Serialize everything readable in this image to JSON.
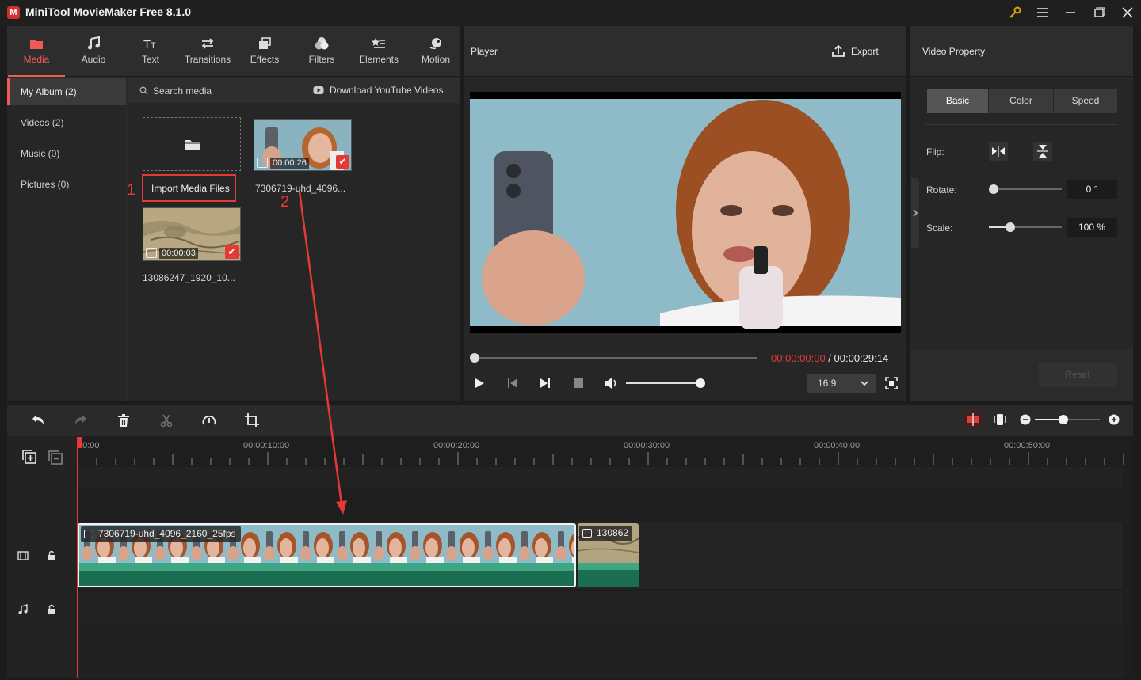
{
  "window": {
    "title": "MiniTool MovieMaker Free 8.1.0",
    "logo_letter": "M"
  },
  "toolbar_tabs": [
    {
      "label": "Media",
      "icon": "media-icon",
      "active": true
    },
    {
      "label": "Audio",
      "icon": "music-note-icon"
    },
    {
      "label": "Text",
      "icon": "text-icon"
    },
    {
      "label": "Transitions",
      "icon": "transitions-icon"
    },
    {
      "label": "Effects",
      "icon": "effects-icon"
    },
    {
      "label": "Filters",
      "icon": "filters-icon"
    },
    {
      "label": "Elements",
      "icon": "elements-icon"
    },
    {
      "label": "Motion",
      "icon": "motion-icon"
    }
  ],
  "album": {
    "items": [
      {
        "label": "My Album (2)",
        "active": true
      },
      {
        "label": "Videos (2)"
      },
      {
        "label": "Music (0)"
      },
      {
        "label": "Pictures (0)"
      }
    ]
  },
  "media": {
    "search_label": "Search media",
    "download_label": "Download YouTube Videos",
    "import_label": "Import Media Files",
    "items": [
      {
        "name": "7306719-uhd_4096...",
        "duration": "00:00:26"
      },
      {
        "name": "13086247_1920_10...",
        "duration": "00:00:03"
      }
    ]
  },
  "annotations": {
    "step1": "1",
    "step2": "2",
    "accent": "#e53935"
  },
  "player": {
    "title": "Player",
    "export_label": "Export",
    "current_time": "00:00:00:00",
    "separator": " / ",
    "total_time": "00:00:29:14",
    "aspect": "16:9",
    "volume": 0.9,
    "progress": 0
  },
  "property": {
    "title": "Video Property",
    "tabs": [
      "Basic",
      "Color",
      "Speed"
    ],
    "active_tab": "Basic",
    "flip_label": "Flip:",
    "rotate_label": "Rotate:",
    "rotate_value": "0 °",
    "scale_label": "Scale:",
    "scale_value": "100 %",
    "reset_label": "Reset"
  },
  "timeline": {
    "ticks": [
      "00:00",
      "00:00:10:00",
      "00:00:20:00",
      "00:00:30:00",
      "00:00:40:00",
      "00:00:50:00"
    ],
    "clip1_label": "7306719-uhd_4096_2160_25fps",
    "clip2_label": "130862"
  },
  "colors": {
    "accent": "#f05a56",
    "clip_green": "#1f7a5a",
    "playhead": "#e53935"
  }
}
